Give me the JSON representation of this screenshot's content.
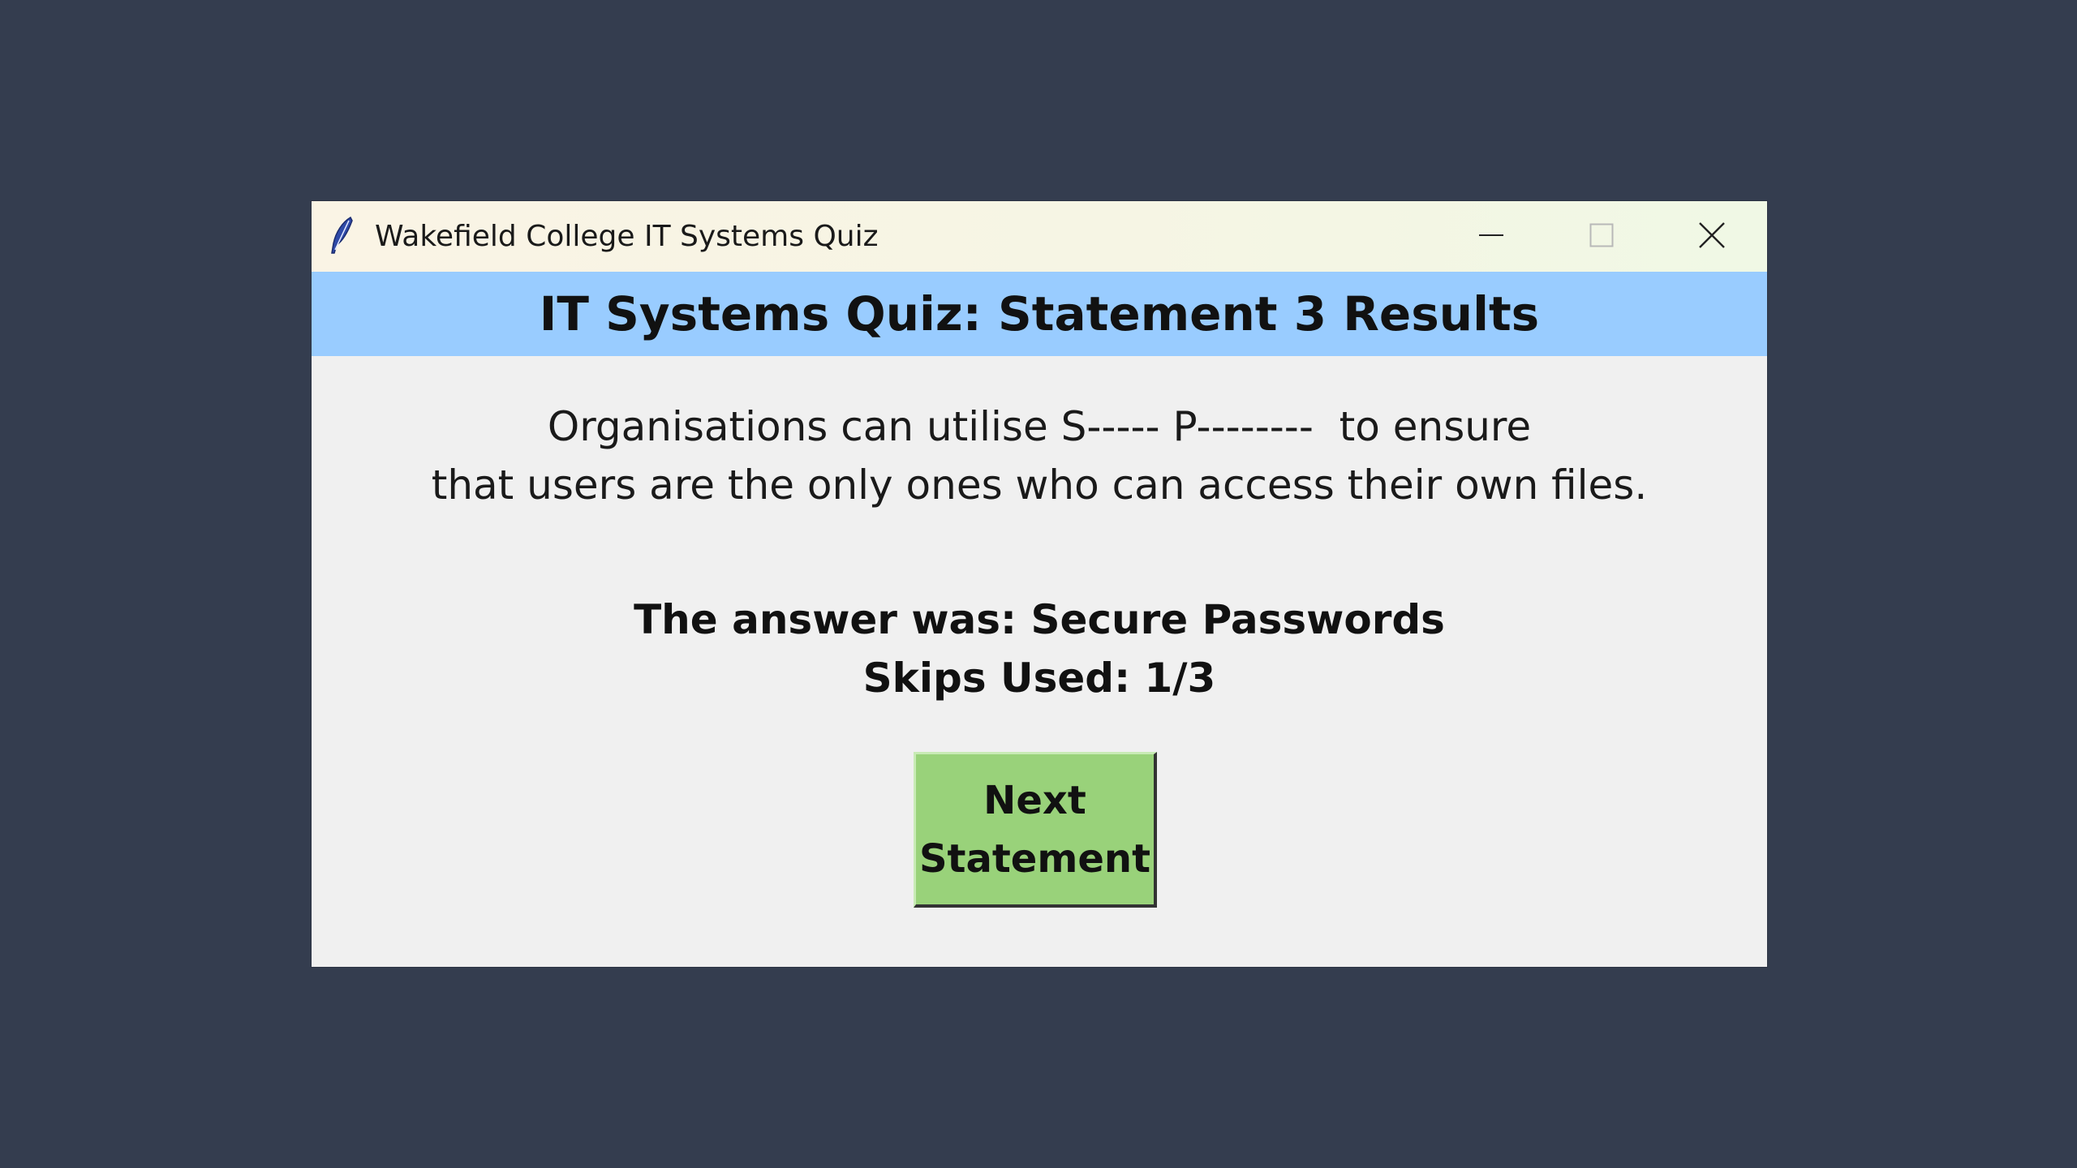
{
  "window": {
    "title": "Wakefield College IT Systems Quiz",
    "icon": "feather-icon",
    "controls": [
      "minimize-icon",
      "maximize-icon",
      "close-icon"
    ]
  },
  "header": {
    "title": "IT Systems Quiz: Statement 3 Results",
    "background": "#99ccff"
  },
  "statement": {
    "line1": "Organisations can utilise S----- P--------  to ensure",
    "line2": "that users are the only ones who can access their own files."
  },
  "result": {
    "answer_text": "The answer was: Secure Passwords",
    "skips_text": "Skips Used: 1/3"
  },
  "next_button": {
    "line1": "Next",
    "line2": "Statement",
    "color": "#99d27a"
  },
  "colors": {
    "desktop": "#343d4f",
    "window_body": "#f0f0f0"
  }
}
